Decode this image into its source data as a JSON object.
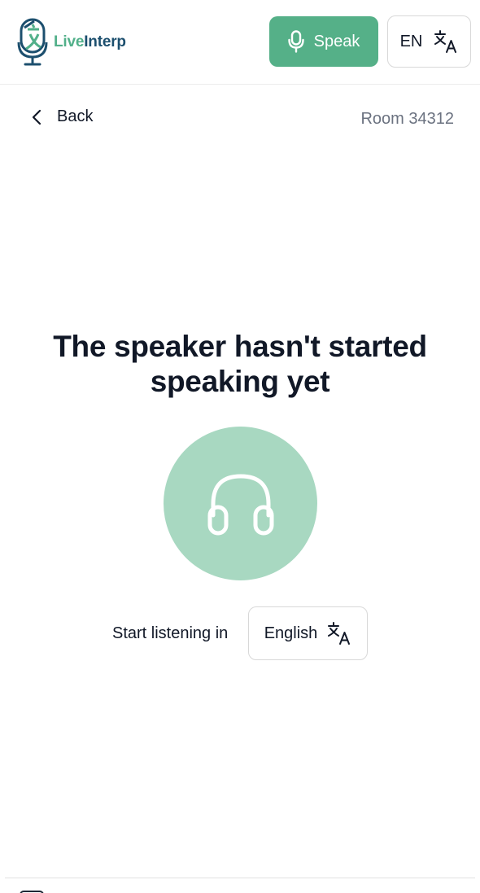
{
  "app": {
    "logo_part1": "Live",
    "logo_part2": "Interp"
  },
  "header": {
    "speak_label": "Speak",
    "language_code": "EN"
  },
  "nav": {
    "back_label": "Back",
    "room_label": "Room 34312"
  },
  "main": {
    "headline_line1": "The speaker hasn't started",
    "headline_line2": "speaking yet",
    "listen_label": "Start listening in",
    "listen_language": "English"
  },
  "colors": {
    "brand_green": "#55b088",
    "brand_blue": "#1c4f6e",
    "circle_green": "#a8d8c1",
    "muted_text": "#6b7280"
  },
  "icons": {
    "logo": "microphone-translate-logo-icon",
    "speak": "microphone-icon",
    "language": "translate-icon",
    "back": "chevron-left-icon",
    "listen": "headphones-icon"
  }
}
